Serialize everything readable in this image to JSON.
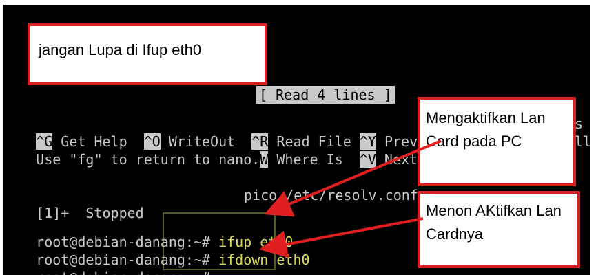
{
  "terminal": {
    "status": "[ Read 4 lines ]",
    "shortcuts_row1": [
      {
        "key": "^G",
        "label": " Get Help  "
      },
      {
        "key": "^O",
        "label": " WriteOut  "
      },
      {
        "key": "^R",
        "label": " Read File "
      },
      {
        "key": "^Y",
        "label": " Prev Page "
      },
      {
        "key": "^",
        "label": ""
      }
    ],
    "shortcuts_row1_tail": "s",
    "row2_text": "Use \"fg\" to return to nano.",
    "shortcuts_row2": [
      {
        "key": "W",
        "label": " Where Is  "
      },
      {
        "key": "^V",
        "label": " Next Page "
      },
      {
        "key": "^",
        "label": ""
      }
    ],
    "shortcuts_row2_tail": "ll",
    "job_line": {
      "left": "[1]+  Stopped",
      "right": "pico /etc/resolv.conf"
    },
    "prompt": "root@debian-danang:~#",
    "commands": [
      "ifup eth0",
      "ifdown eth0",
      ""
    ]
  },
  "callouts": {
    "top": "jangan Lupa di Ifup eth0",
    "ifup": "Mengaktifkan Lan\nCard pada PC",
    "ifdown": "Menon AKtifkan Lan\nCardnya"
  },
  "colors": {
    "callout_border": "#d92020",
    "arrow": "#e02020",
    "command": "#d8d85a"
  }
}
